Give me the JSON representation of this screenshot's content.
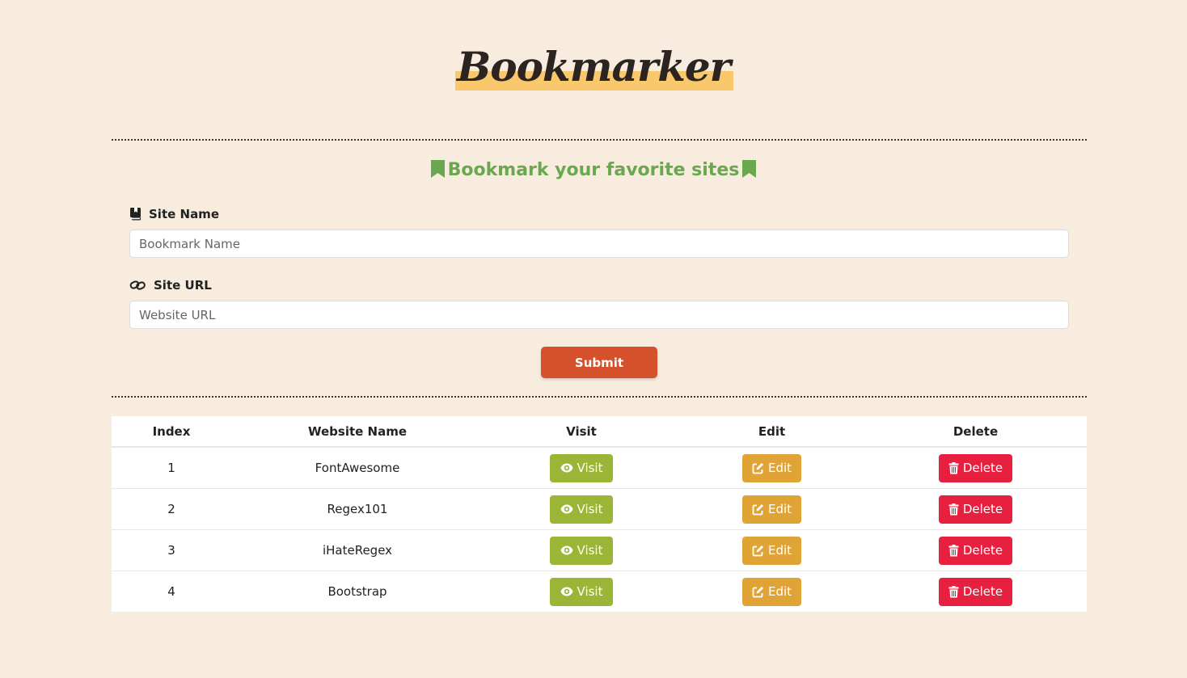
{
  "header": {
    "logo_text": "Bookmarker",
    "subtitle": "Bookmark your favorite sites"
  },
  "form": {
    "site_name_label": "Site Name",
    "site_name_placeholder": "Bookmark Name",
    "site_url_label": "Site URL",
    "site_url_placeholder": "Website URL",
    "submit_label": "Submit"
  },
  "table": {
    "columns": [
      "Index",
      "Website Name",
      "Visit",
      "Edit",
      "Delete"
    ],
    "rows": [
      {
        "index": "1",
        "name": "FontAwesome",
        "visit": "Visit",
        "edit": "Edit",
        "delete": "Delete"
      },
      {
        "index": "2",
        "name": "Regex101",
        "visit": "Visit",
        "edit": "Edit",
        "delete": "Delete"
      },
      {
        "index": "3",
        "name": "iHateRegex",
        "visit": "Visit",
        "edit": "Edit",
        "delete": "Delete"
      },
      {
        "index": "4",
        "name": "Bootstrap",
        "visit": "Visit",
        "edit": "Edit",
        "delete": "Delete"
      }
    ]
  },
  "colors": {
    "background": "#f8ecdf",
    "accent_green": "#6aa84f",
    "submit": "#d4512b",
    "visit": "#9bb536",
    "edit": "#e0a336",
    "delete": "#e8203f",
    "logo_highlight": "#f9c86c"
  },
  "icons": {
    "subtitle": "bookmark-icon",
    "site_name": "book-bookmark-icon",
    "site_url": "link-icon",
    "visit": "eye-icon",
    "edit": "pen-to-square-icon",
    "delete": "trash-icon"
  }
}
